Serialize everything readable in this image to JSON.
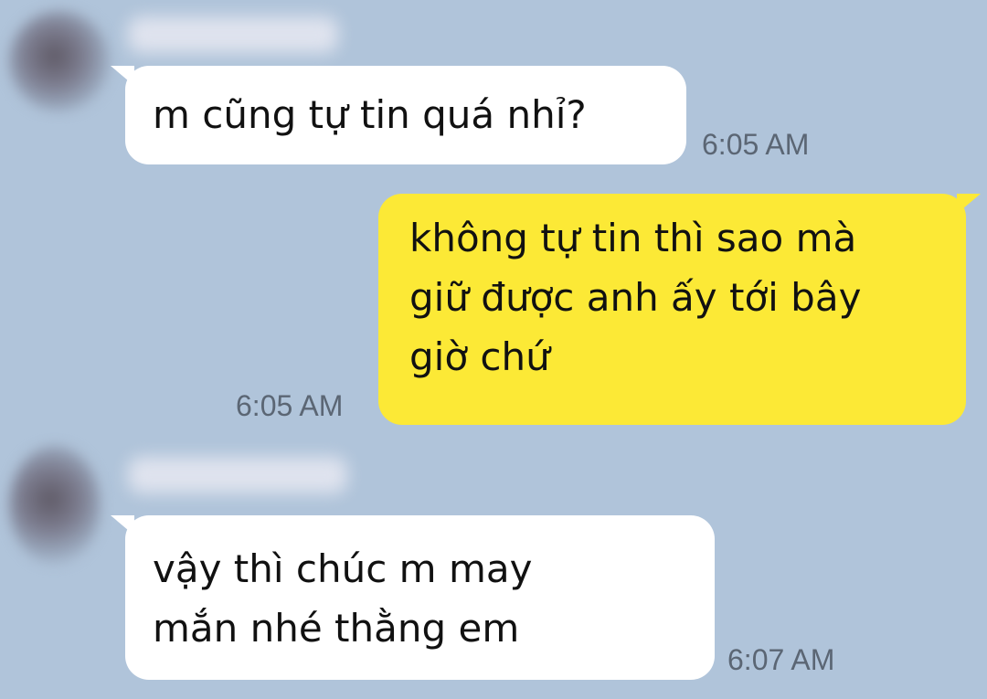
{
  "messages": [
    {
      "sender": "other",
      "text": "m cũng tự tin quá nhỉ?",
      "time": "6:05 AM"
    },
    {
      "sender": "me",
      "text": "không tự tin thì sao mà\ngiữ được anh ấy tới bây\ngiờ chứ",
      "time": "6:05 AM"
    },
    {
      "sender": "other",
      "text": "vậy thì chúc m may\nmắn nhé thằng em",
      "time": "6:07 AM"
    }
  ],
  "colors": {
    "background": "#b0c4da",
    "incoming_bubble": "#ffffff",
    "outgoing_bubble": "#fce936",
    "timestamp": "#5b6674"
  }
}
